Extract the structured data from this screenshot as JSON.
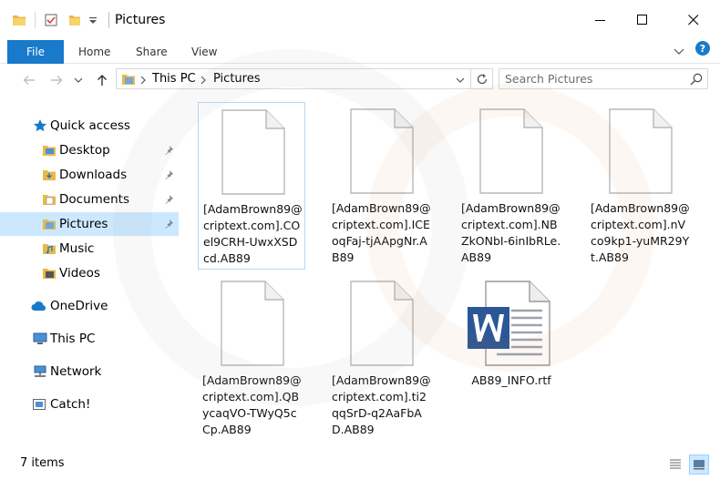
{
  "window": {
    "title": "Pictures"
  },
  "ribbon": {
    "tabs": [
      "File",
      "Home",
      "Share",
      "View"
    ],
    "help": "?"
  },
  "address": {
    "crumbs": [
      "This PC",
      "Pictures"
    ],
    "search_placeholder": "Search Pictures"
  },
  "sidebar": {
    "quick_access": "Quick access",
    "items": [
      "Desktop",
      "Downloads",
      "Documents",
      "Pictures",
      "Music",
      "Videos"
    ],
    "onedrive": "OneDrive",
    "thispc": "This PC",
    "network": "Network",
    "catch": "Catch!"
  },
  "files": [
    {
      "name": "[AdamBrown89@criptext.com].COel9CRH-UwxXSDcd.AB89",
      "type": "generic"
    },
    {
      "name": "[AdamBrown89@criptext.com].ICEoqFaj-tjAApgNr.AB89",
      "type": "generic"
    },
    {
      "name": "[AdamBrown89@criptext.com].NBZkONbI-6inIbRLe.AB89",
      "type": "generic"
    },
    {
      "name": "[AdamBrown89@criptext.com].nVco9kp1-yuMR29Yt.AB89",
      "type": "generic"
    },
    {
      "name": "[AdamBrown89@criptext.com].QBycaqVO-TWyQ5cCp.AB89",
      "type": "generic"
    },
    {
      "name": "[AdamBrown89@criptext.com].ti2qqSrD-q2AaFbAD.AB89",
      "type": "generic"
    },
    {
      "name": "AB89_INFO.rtf",
      "type": "word"
    }
  ],
  "status": {
    "count": "7 items"
  },
  "colors": {
    "accent": "#1979ca",
    "selection": "#cce8ff",
    "folder": "#e8b949"
  }
}
